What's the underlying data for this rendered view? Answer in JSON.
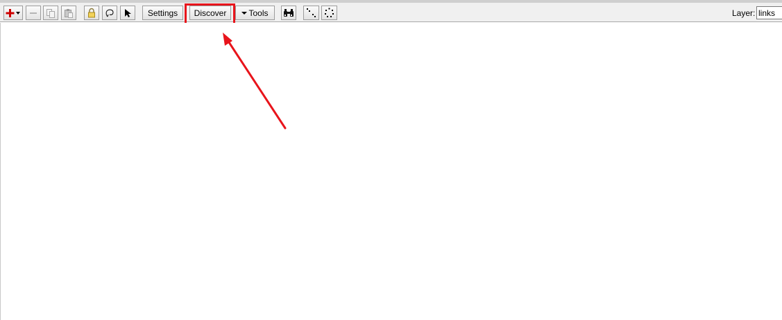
{
  "toolbar": {
    "add_button_icon": "red-plus-icon",
    "remove_button_icon": "minus-icon",
    "copy_button_icon": "copy-icon",
    "paste_button_icon": "paste-icon",
    "lock_button_icon": "lock-icon",
    "lasso_button_icon": "lasso-icon",
    "pointer_button_icon": "pointer-icon",
    "settings_label": "Settings",
    "discover_label": "Discover",
    "tools_label": "Tools",
    "find_button_icon": "binoculars-icon",
    "layout_button_icon": "diagonal-dots-icon",
    "circle_layout_button_icon": "circle-dots-icon",
    "layer_label": "Layer:",
    "layer_value": "links"
  },
  "annotation": {
    "highlight_color": "#e8141b",
    "arrow_color": "#e8141b"
  },
  "colors": {
    "add_icon_red": "#cc0000",
    "toolbar_background": "#f0f0f0",
    "canvas_background": "#ffffff"
  }
}
